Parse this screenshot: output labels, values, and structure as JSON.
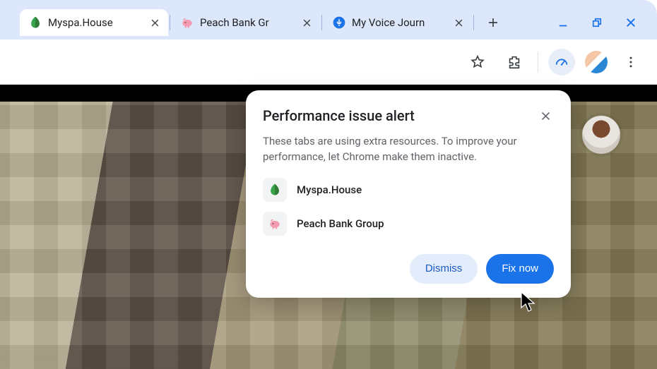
{
  "tabs": [
    {
      "title": "Myspa.House",
      "favicon": "leaf",
      "active": true
    },
    {
      "title": "Peach Bank Gr",
      "favicon": "piggy",
      "active": false
    },
    {
      "title": "My Voice Journ",
      "favicon": "voice",
      "active": false
    }
  ],
  "popup": {
    "title": "Performance issue alert",
    "description": "These tabs are using extra resources. To improve your performance, let Chrome make them inactive.",
    "items": [
      {
        "label": "Myspa.House",
        "icon": "leaf"
      },
      {
        "label": "Peach Bank Group",
        "icon": "piggy"
      }
    ],
    "dismiss_label": "Dismiss",
    "fix_label": "Fix now"
  },
  "colors": {
    "accent": "#1a73e8",
    "tab_bg": "#dde7fb"
  }
}
